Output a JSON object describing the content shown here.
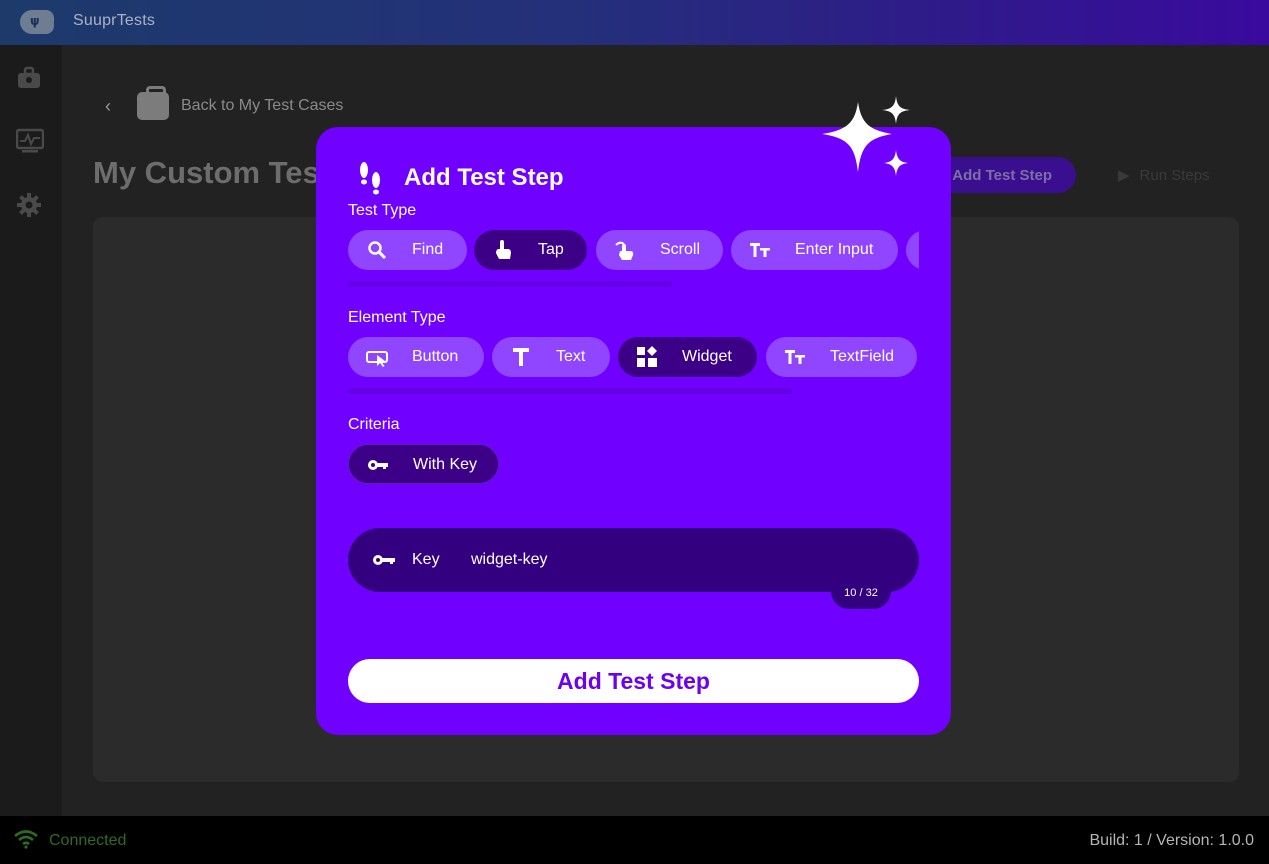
{
  "app": {
    "title": "SuuprTests"
  },
  "sidebar": {
    "items": [
      {
        "icon": "briefcase-icon"
      },
      {
        "icon": "monitor-chart-icon"
      },
      {
        "icon": "gear-icon"
      }
    ]
  },
  "page": {
    "back_label": "Back to My Test Cases",
    "title": "My Custom Test",
    "add_step_label": "Add Test Step",
    "run_steps_label": "Run Steps"
  },
  "modal": {
    "title": "Add Test Step",
    "test_type_label": "Test Type",
    "test_types": [
      {
        "label": "Find",
        "icon": "search-icon",
        "selected": false
      },
      {
        "label": "Tap",
        "icon": "tap-hand-icon",
        "selected": true
      },
      {
        "label": "Scroll",
        "icon": "swipe-hand-icon",
        "selected": false
      },
      {
        "label": "Enter Input",
        "icon": "text-size-icon",
        "selected": false
      }
    ],
    "element_type_label": "Element Type",
    "element_types": [
      {
        "label": "Button",
        "icon": "button-cursor-icon",
        "selected": false
      },
      {
        "label": "Text",
        "icon": "text-t-icon",
        "selected": false
      },
      {
        "label": "Widget",
        "icon": "widgets-icon",
        "selected": true
      },
      {
        "label": "TextField",
        "icon": "text-size-icon",
        "selected": false
      }
    ],
    "criteria_label": "Criteria",
    "criteria": [
      {
        "label": "With Key",
        "icon": "key-icon",
        "selected": true
      }
    ],
    "key_field": {
      "label": "Key",
      "value": "widget-key",
      "counter": "10 / 32"
    },
    "submit_label": "Add Test Step"
  },
  "status": {
    "connection": "Connected",
    "build": "Build: 1 / Version: 1.0.0",
    "connected_color": "#2f6b1e"
  },
  "colors": {
    "accent": "#7000ff",
    "chip": "#9046ff",
    "chip_selected": "#3b0086"
  }
}
